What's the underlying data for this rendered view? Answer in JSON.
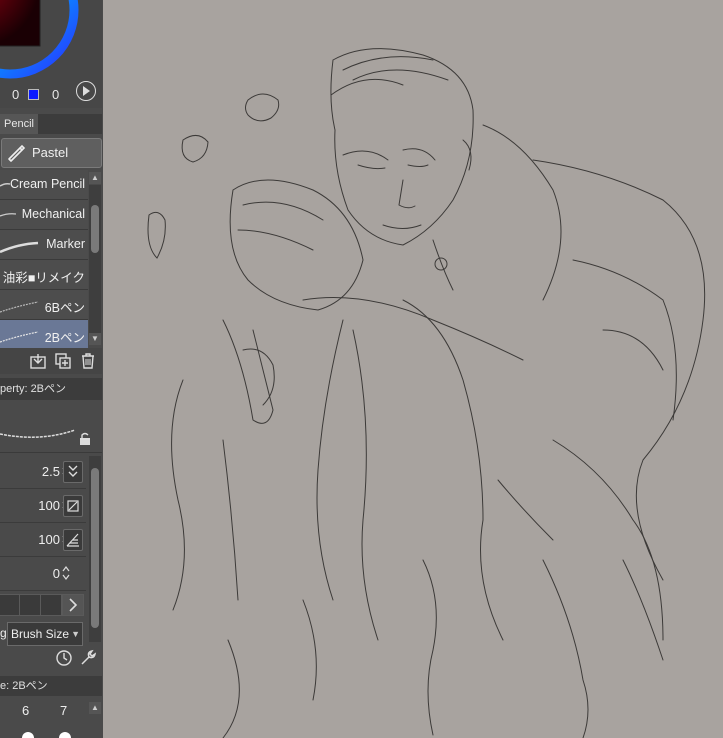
{
  "color_wheel": {
    "value_left": "0",
    "value_right": "0"
  },
  "palette_tab": "Pencil",
  "pastel_button": "Pastel",
  "brushes": [
    {
      "label": "Cream Pencil",
      "selected": false
    },
    {
      "label": "Mechanical",
      "selected": false
    },
    {
      "label": "Marker",
      "selected": false
    },
    {
      "label": "油彩■リメイク",
      "selected": false
    },
    {
      "label": "6Bペン",
      "selected": false
    },
    {
      "label": "2Bペン",
      "selected": true
    }
  ],
  "tool_property": {
    "title": "perty: 2Bペン"
  },
  "properties": [
    {
      "value": "2.5",
      "icon": "pressure-icon"
    },
    {
      "value": "100",
      "icon": "opacity-icon"
    },
    {
      "value": "100",
      "icon": "density-icon"
    },
    {
      "value": "0",
      "icon": ""
    }
  ],
  "brush_size_select": {
    "prefix": "g",
    "value": "Brush Size"
  },
  "brush_size_panel": {
    "title": "e: 2Bペン",
    "numbers": [
      "6",
      "7"
    ]
  },
  "colors": {
    "canvas": "#a8a39f",
    "panel": "#4a4a4a",
    "selected": "#6a7896",
    "blue": "#0a1aff"
  }
}
